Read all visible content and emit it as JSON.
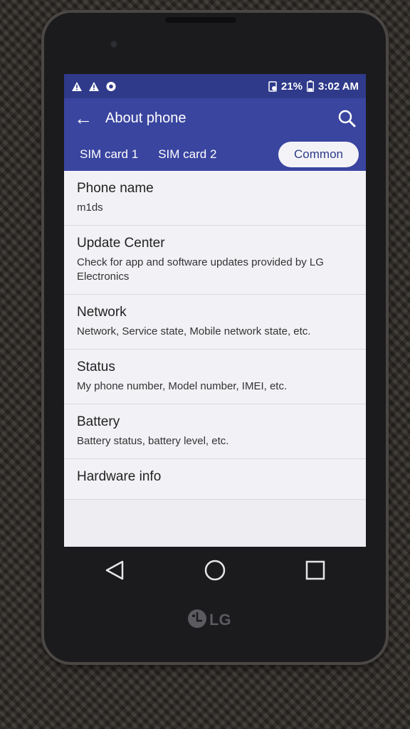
{
  "status_bar": {
    "battery": "21%",
    "time": "3:02 AM",
    "icons": [
      "warning-icon",
      "warning-icon",
      "notification-icon",
      "battery-saver-icon",
      "battery-icon"
    ]
  },
  "app_bar": {
    "title": "About phone",
    "back_icon": "back-arrow-icon",
    "search_icon": "search-icon"
  },
  "tabs": [
    {
      "label": "SIM card 1"
    },
    {
      "label": "SIM card 2"
    },
    {
      "label": "Common"
    }
  ],
  "items": [
    {
      "title": "Phone name",
      "subtitle": "m1ds"
    },
    {
      "title": "Update Center",
      "subtitle": "Check for app and software updates provided by LG Electronics"
    },
    {
      "title": "Network",
      "subtitle": "Network, Service state, Mobile network state, etc."
    },
    {
      "title": "Status",
      "subtitle": "My phone number, Model number, IMEI, etc."
    },
    {
      "title": "Battery",
      "subtitle": "Battery status, battery level, etc."
    },
    {
      "title": "Hardware info",
      "subtitle": ""
    }
  ],
  "brand": "LG",
  "colors": {
    "accent": "#3a45a0",
    "status_bar": "#2f3a8a",
    "list_bg": "#f2f2f6"
  }
}
